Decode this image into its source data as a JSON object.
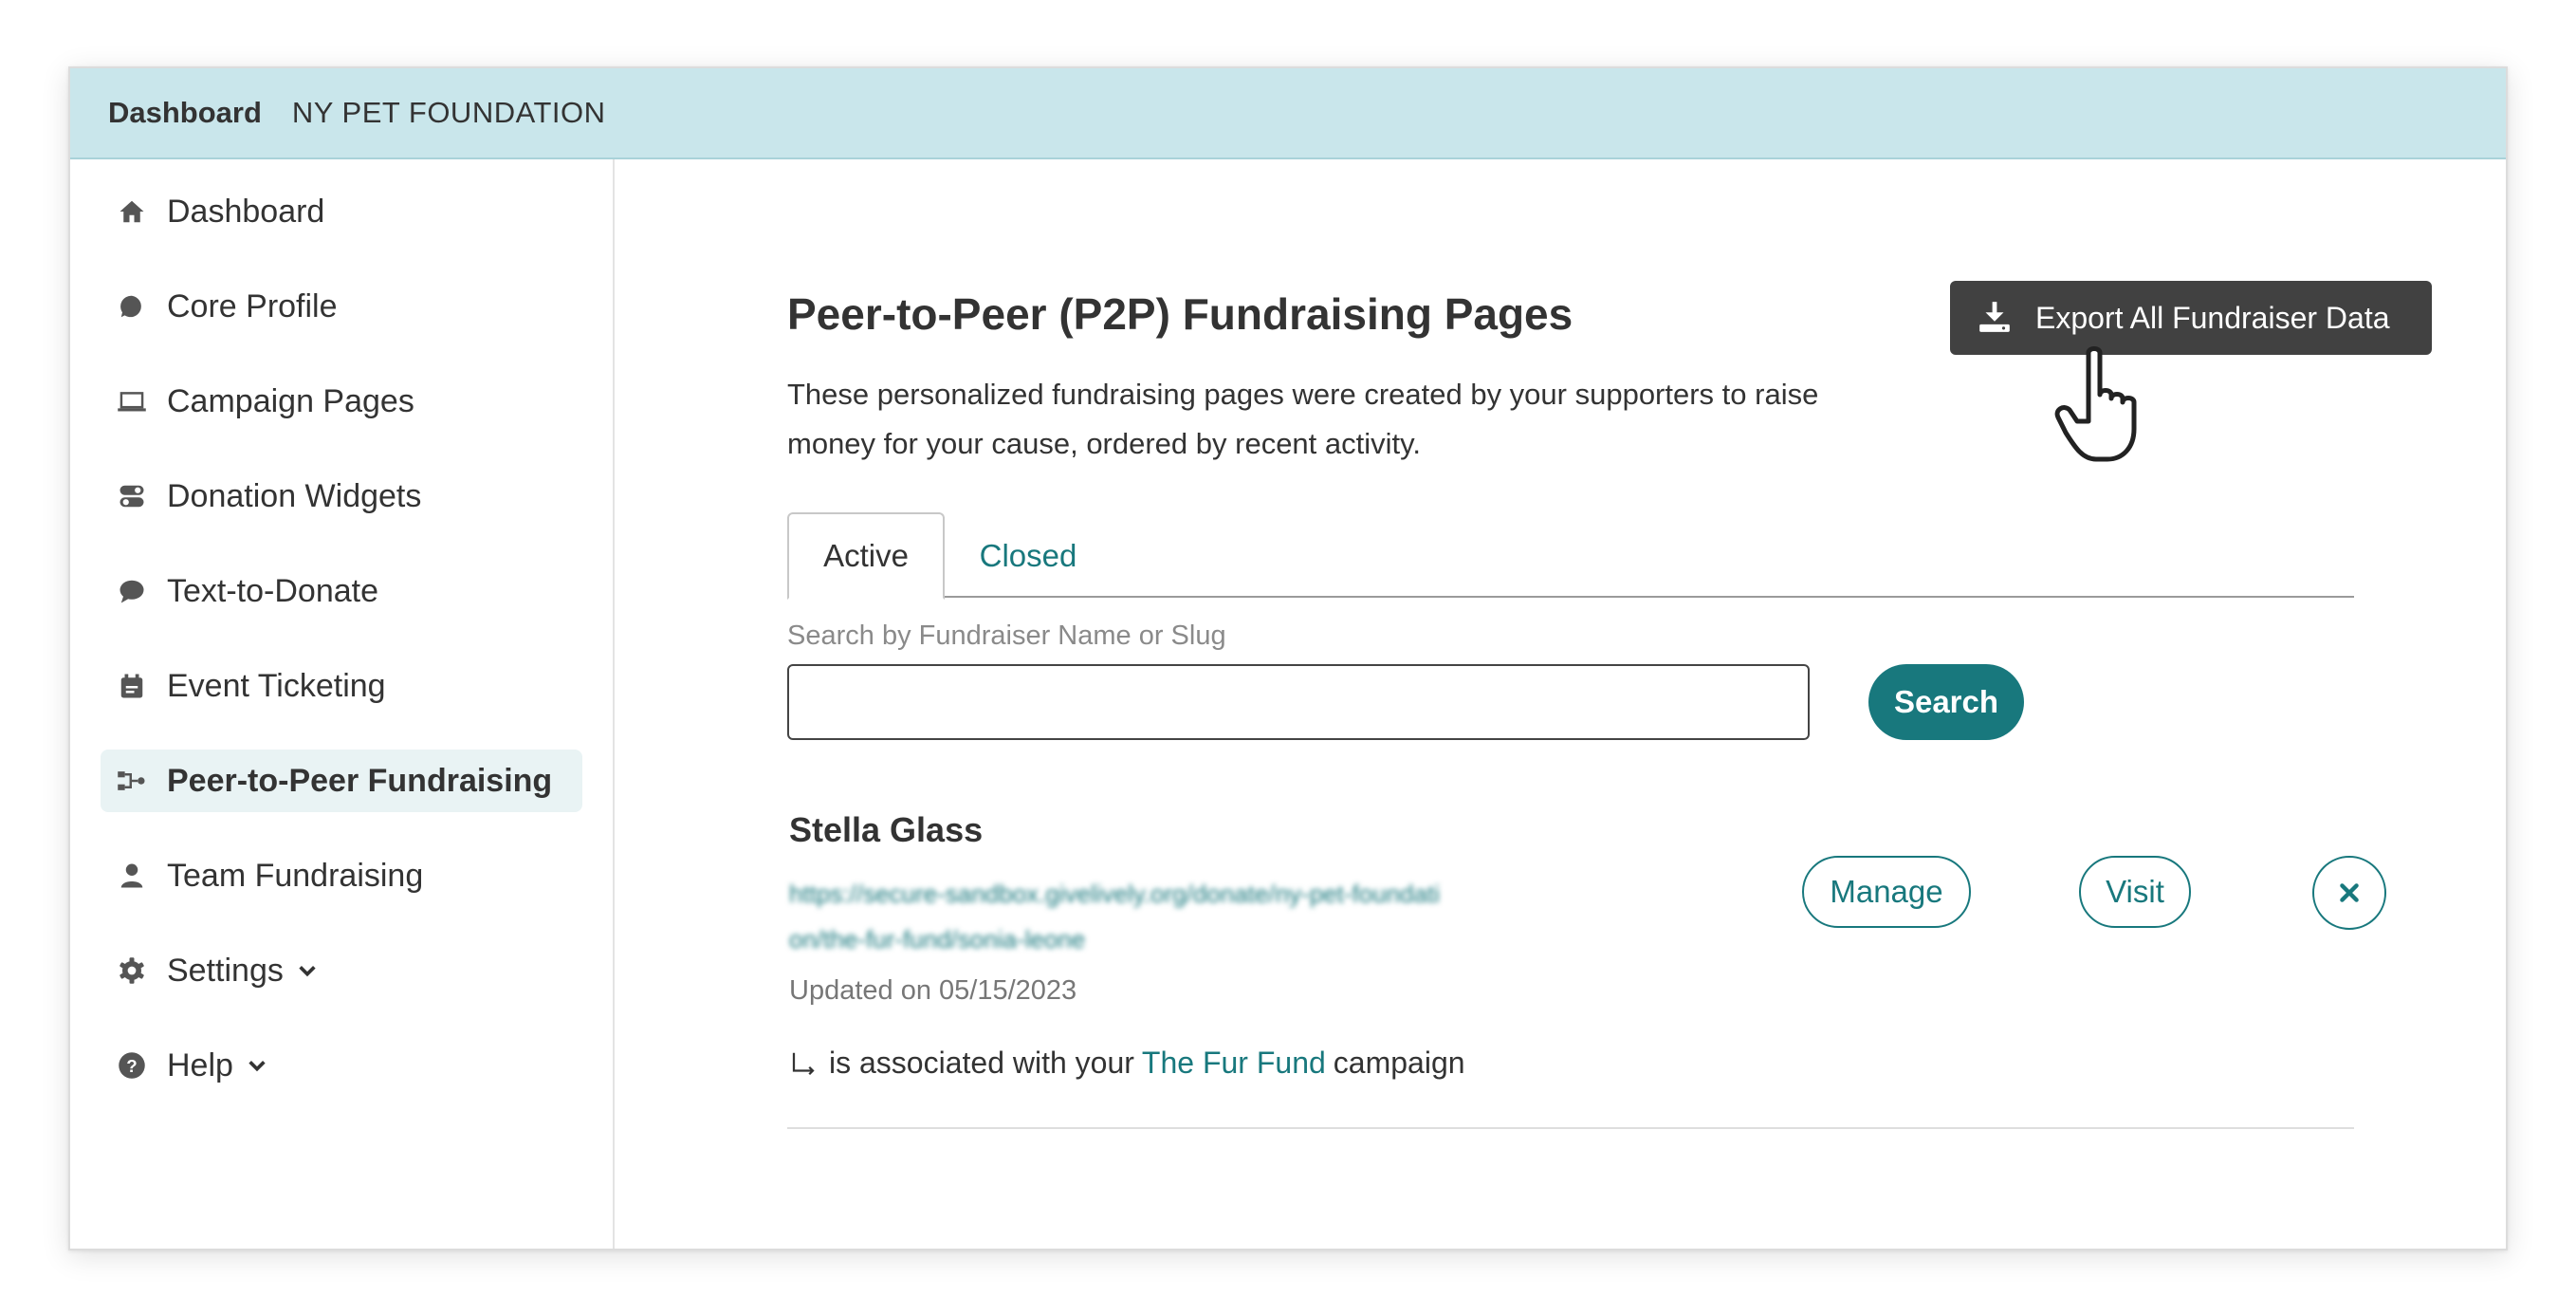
{
  "topbar": {
    "brand": "Dashboard",
    "org": "NY PET FOUNDATION"
  },
  "sidebar": {
    "items": [
      {
        "label": "Dashboard",
        "icon": "home-icon"
      },
      {
        "label": "Core Profile",
        "icon": "speech-bubble-icon"
      },
      {
        "label": "Campaign Pages",
        "icon": "laptop-icon"
      },
      {
        "label": "Donation Widgets",
        "icon": "toggle-icon"
      },
      {
        "label": "Text-to-Donate",
        "icon": "chat-icon"
      },
      {
        "label": "Event Ticketing",
        "icon": "calendar-icon"
      },
      {
        "label": "Peer-to-Peer Fundraising",
        "icon": "p2p-icon",
        "active": true
      },
      {
        "label": "Team Fundraising",
        "icon": "user-icon"
      },
      {
        "label": "Settings",
        "icon": "gear-icon",
        "expandable": true
      },
      {
        "label": "Help",
        "icon": "question-icon",
        "expandable": true
      }
    ]
  },
  "main": {
    "title": "Peer-to-Peer (P2P) Fundraising Pages",
    "description": "These personalized fundraising pages were created by your supporters to raise money for your cause, ordered by recent activity.",
    "export_button": "Export All Fundraiser Data",
    "tabs": [
      {
        "label": "Active",
        "active": true
      },
      {
        "label": "Closed",
        "active": false
      }
    ],
    "search": {
      "label": "Search by Fundraiser Name or Slug",
      "value": "",
      "button": "Search"
    },
    "fundraisers": [
      {
        "name": "Stella Glass",
        "url": "https://secure-sandbox.givelively.org/donate/ny-pet-foundation/the-fur-fund/sonia-leone",
        "manage_label": "Manage",
        "visit_label": "Visit",
        "updated": "Updated on 05/15/2023",
        "assoc_prefix": "is associated with your",
        "campaign": "The Fur Fund",
        "assoc_suffix": "campaign"
      }
    ]
  },
  "colors": {
    "accent": "#18787d",
    "topbar_bg": "#c9e6eb",
    "export_bg": "#414141",
    "active_nav_bg": "#e9f3f4"
  }
}
